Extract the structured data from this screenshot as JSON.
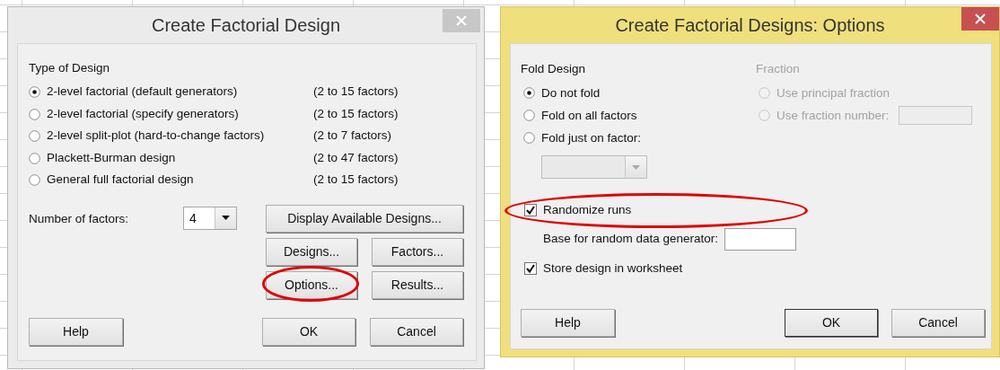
{
  "main_dialog": {
    "title": "Create Factorial Design",
    "active": false,
    "type_group": {
      "label": "Type of Design",
      "options": [
        {
          "label": "2-level factorial (default generators)",
          "range": "(2 to 15 factors)",
          "selected": true
        },
        {
          "label": "2-level factorial (specify generators)",
          "range": "(2 to 15 factors)",
          "selected": false
        },
        {
          "label": "2-level split-plot (hard-to-change factors)",
          "range": "(2 to 7 factors)",
          "selected": false
        },
        {
          "label": "Plackett-Burman design",
          "range": "(2 to 47 factors)",
          "selected": false
        },
        {
          "label": "General full factorial design",
          "range": "(2 to 15 factors)",
          "selected": false
        }
      ]
    },
    "number_of_factors": {
      "label": "Number of factors:",
      "value": "4"
    },
    "buttons": [
      {
        "label": "Display Available Designs...",
        "circled": false
      },
      {
        "label": "Designs...",
        "circled": false
      },
      {
        "label": "Factors...",
        "circled": false
      },
      {
        "label": "Options...",
        "circled": true
      },
      {
        "label": "Results...",
        "circled": false
      }
    ],
    "footer": {
      "help": "Help",
      "ok": "OK",
      "cancel": "Cancel"
    }
  },
  "options_dialog": {
    "title": "Create Factorial Designs: Options",
    "active": true,
    "fold_design": {
      "label": "Fold Design",
      "options": [
        {
          "label": "Do not fold",
          "selected": true
        },
        {
          "label": "Fold on all factors",
          "selected": false
        },
        {
          "label": "Fold just on factor:",
          "selected": false
        }
      ],
      "factor_select": {
        "disabled": true
      }
    },
    "fraction": {
      "label": "Fraction",
      "disabled": true,
      "options": [
        {
          "label": "Use principal fraction",
          "selected": false
        },
        {
          "label": "Use fraction number:",
          "selected": false
        }
      ]
    },
    "settings": [
      {
        "kind": "checkbox",
        "label": "Randomize runs",
        "checked": true,
        "circled": true
      },
      {
        "kind": "field",
        "label": "Base for random data generator:"
      },
      {
        "kind": "checkbox",
        "label": "Store design in worksheet",
        "checked": true,
        "circled": false
      }
    ],
    "footer": {
      "help": "Help",
      "ok": "OK",
      "cancel": "Cancel"
    }
  }
}
